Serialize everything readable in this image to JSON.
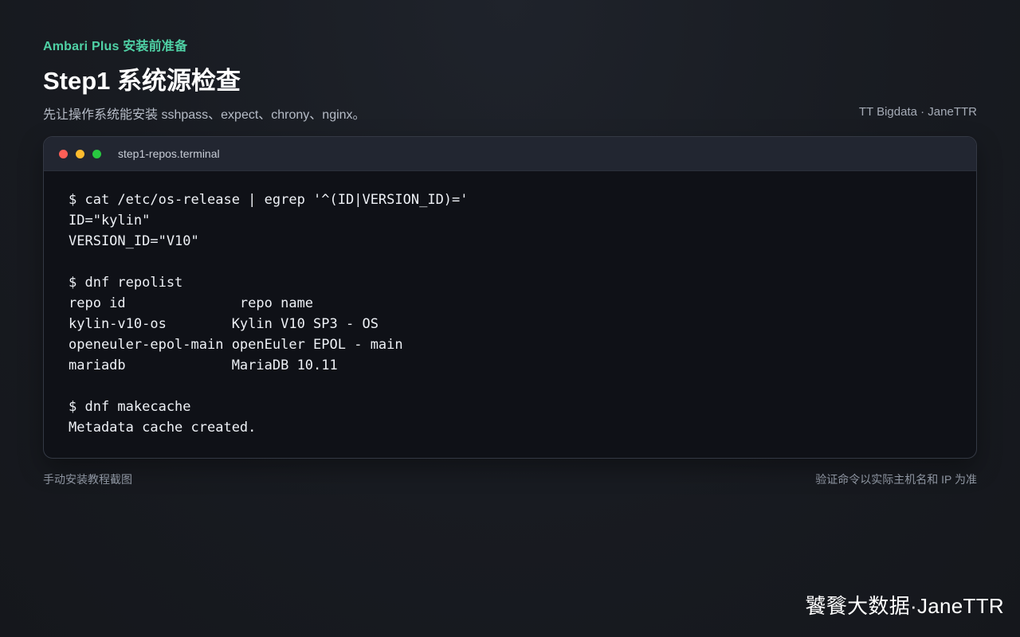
{
  "header": {
    "eyebrow": "Ambari Plus 安装前准备",
    "title": "Step1 系统源检查",
    "subtitle": "先让操作系统能安装 sshpass、expect、chrony、nginx。",
    "byline": "TT Bigdata · JaneTTR"
  },
  "terminal": {
    "window_title": "step1-repos.terminal",
    "lines": [
      "$ cat /etc/os-release | egrep '^(ID|VERSION_ID)='",
      "ID=\"kylin\"",
      "VERSION_ID=\"V10\"",
      "",
      "$ dnf repolist",
      "repo id              repo name",
      "kylin-v10-os        Kylin V10 SP3 - OS",
      "openeuler-epol-main openEuler EPOL - main",
      "mariadb             MariaDB 10.11",
      "",
      "$ dnf makecache",
      "Metadata cache created."
    ]
  },
  "footer": {
    "left": "手动安装教程截图",
    "right": "验证命令以实际主机名和 IP 为准"
  },
  "watermark": "饕餮大数据·JaneTTR",
  "colors": {
    "accent": "#4fd1a5",
    "traffic_red": "#fe5f57",
    "traffic_yellow": "#febc2e",
    "traffic_green": "#28c840"
  }
}
